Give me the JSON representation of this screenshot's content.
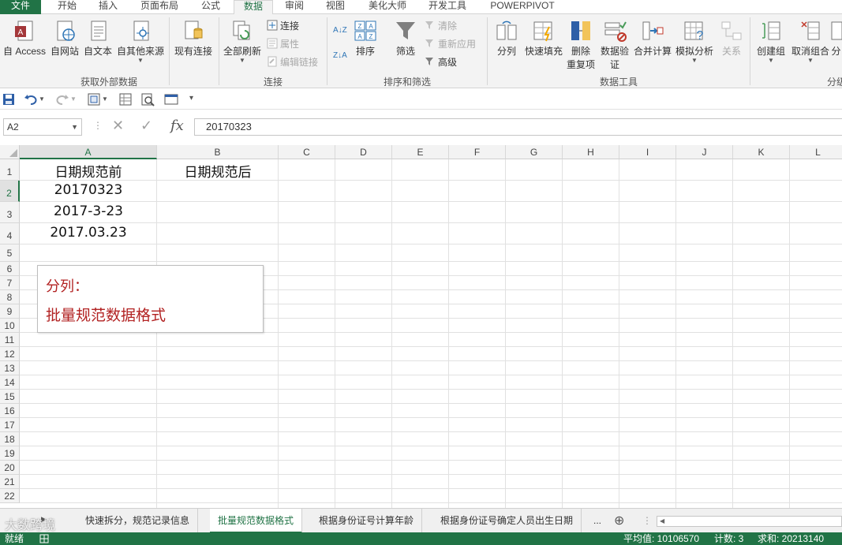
{
  "menu": {
    "tabs": [
      "文件",
      "开始",
      "插入",
      "页面布局",
      "公式",
      "数据",
      "审阅",
      "视图",
      "美化大师",
      "开发工具",
      "POWERPIVOT"
    ],
    "active_tab": "数据"
  },
  "ribbon": {
    "groups": {
      "external": "获取外部数据",
      "connections": "连接",
      "sort_filter": "排序和筛选",
      "data_tools": "数据工具",
      "outline": "分级"
    },
    "buttons": {
      "from_access": "自 Access",
      "from_web": "自网站",
      "from_text": "自文本",
      "from_other": "自其他来源",
      "existing_conn": "现有连接",
      "refresh_all": "全部刷新",
      "connections": "连接",
      "properties": "属性",
      "edit_links": "编辑链接",
      "sort_az": "A↓Z",
      "sort_za": "Z↓A",
      "sort": "排序",
      "filter": "筛选",
      "clear": "清除",
      "reapply": "重新应用",
      "advanced": "高级",
      "text_to_columns": "分列",
      "flash_fill": "快速填充",
      "remove_dup_1": "删除",
      "remove_dup_2": "重复项",
      "data_validation_1": "数据验",
      "data_validation_2": "证",
      "consolidate": "合并计算",
      "what_if": "模拟分析",
      "relationships": "关系",
      "group": "创建组",
      "ungroup": "取消组合",
      "subtotal": "分"
    }
  },
  "formula_bar": {
    "name_box": "A2",
    "cancel_glyph": "✕",
    "enter_glyph": "✓",
    "fx_label": "fx",
    "content": "20170323"
  },
  "grid": {
    "columns": [
      "A",
      "B",
      "C",
      "D",
      "E",
      "F",
      "G",
      "H",
      "I",
      "J",
      "K",
      "L"
    ],
    "rows": [
      "1",
      "2",
      "3",
      "4",
      "5",
      "6",
      "7",
      "8",
      "9",
      "10",
      "11",
      "12",
      "13",
      "14",
      "15",
      "16",
      "17",
      "18",
      "19",
      "20",
      "21",
      "22"
    ],
    "cells": {
      "A1": "日期规范前",
      "B1": "日期规范后",
      "A2": "20170323",
      "A3": "2017-3-23",
      "A4": "2017.03.23"
    }
  },
  "note": {
    "line1": "分列：",
    "line2": "批量规范数据格式"
  },
  "sheets": {
    "tabs": [
      "快速拆分，规范记录信息",
      "批量规范数据格式",
      "根据身份证号计算年龄",
      "根据身份证号确定人员出生日期"
    ],
    "active": "批量规范数据格式",
    "more": "...",
    "add": "⊕"
  },
  "status": {
    "ready": "就绪",
    "average": "平均值: 10106570",
    "count": "计数: 3",
    "sum": "求和: 20213140"
  },
  "watermark": "大数跨境",
  "colors": {
    "accent": "#217346",
    "note_text": "#b22222"
  }
}
